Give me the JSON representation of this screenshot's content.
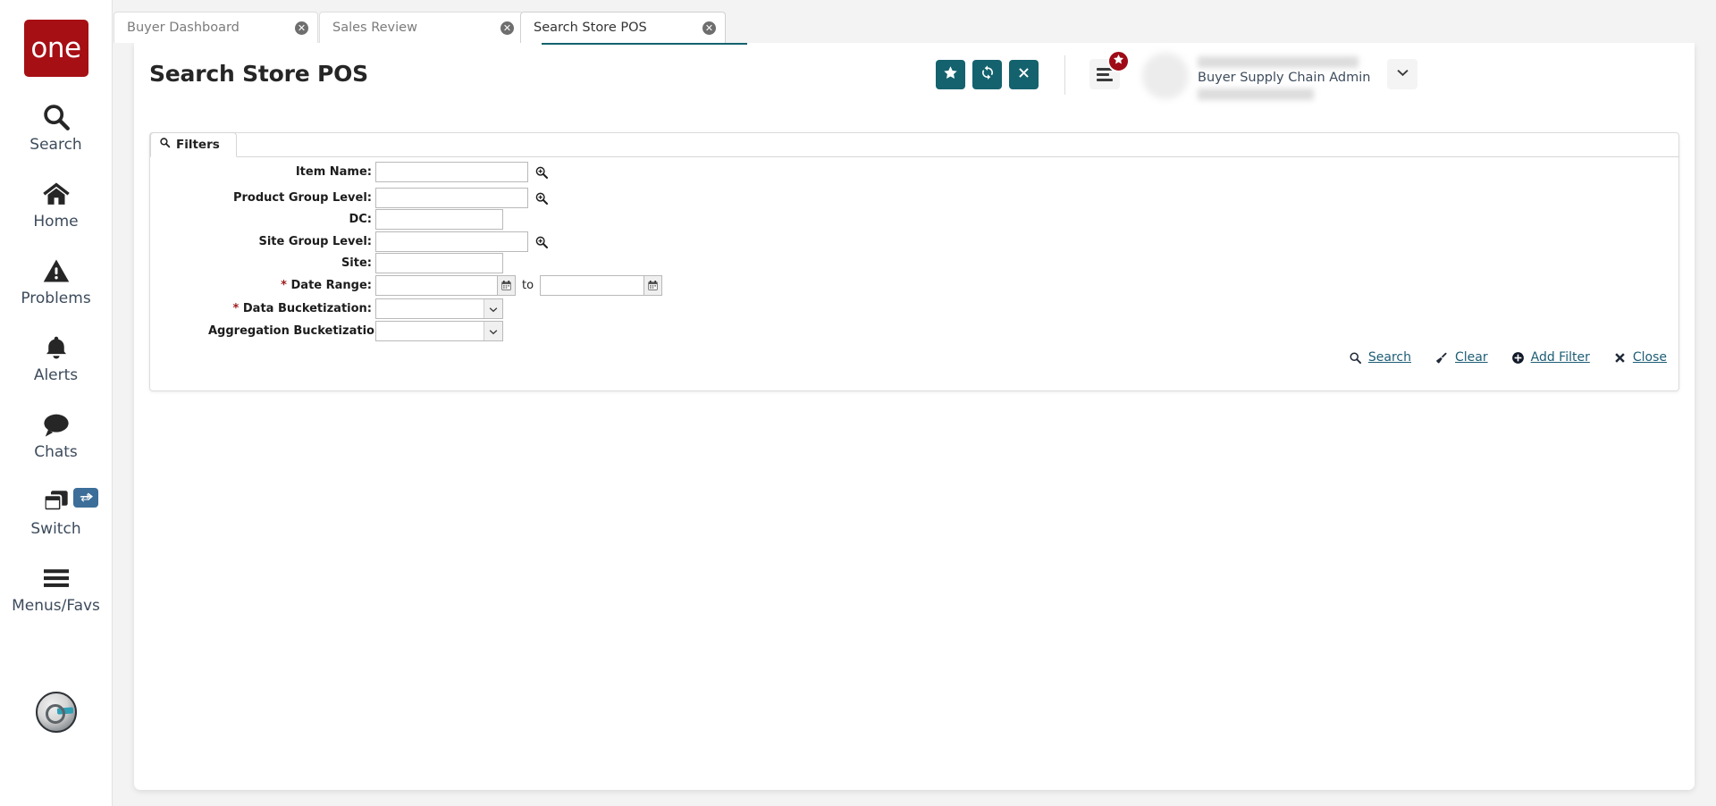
{
  "sidebar": {
    "logo_text": "one",
    "items": [
      {
        "label": "Search",
        "icon": "search-icon"
      },
      {
        "label": "Home",
        "icon": "home-icon"
      },
      {
        "label": "Problems",
        "icon": "warning-triangle-icon"
      },
      {
        "label": "Alerts",
        "icon": "bell-icon"
      },
      {
        "label": "Chats",
        "icon": "chat-bubble-icon"
      },
      {
        "label": "Switch",
        "icon": "windows-stack-icon",
        "badge_icon": "swap-arrows-icon"
      },
      {
        "label": "Menus/Favs",
        "icon": "hamburger-icon"
      }
    ],
    "assistant_icon": "ai-assistant-avatar-icon"
  },
  "tabs": [
    {
      "label": "Buyer Dashboard",
      "active": false,
      "close_icon": "close-circle-icon"
    },
    {
      "label": "Sales Review",
      "active": false,
      "close_icon": "close-circle-icon"
    },
    {
      "label": "Search Store POS",
      "active": true,
      "close_icon": "close-circle-icon"
    }
  ],
  "header": {
    "title": "Search Store POS",
    "buttons": [
      {
        "name": "favorite-button",
        "icon": "star-icon"
      },
      {
        "name": "refresh-button",
        "icon": "refresh-icon"
      },
      {
        "name": "close-button",
        "icon": "x-icon"
      }
    ],
    "menu_icon": "hamburger-menu-icon",
    "favorites_badge_icon": "star-icon",
    "user": {
      "name_masked": "██████ ██████",
      "role": "Buyer Supply Chain Admin",
      "org_masked": "████ ████"
    },
    "user_caret_icon": "chevron-down-icon",
    "accent_color": "#14626e",
    "badge_color": "#9e0b16"
  },
  "filters": {
    "tab_label": "Filters",
    "tab_icon": "search-icon",
    "rows": [
      {
        "label": "Item Name:",
        "required": false,
        "type": "text",
        "value": "",
        "lookup": true,
        "width": "long"
      },
      {
        "label": "Product Group Level:",
        "required": false,
        "type": "text",
        "value": "",
        "lookup": true,
        "width": "long"
      },
      {
        "label": "DC:",
        "required": false,
        "type": "text",
        "value": "",
        "lookup": false,
        "width": "short"
      },
      {
        "label": "Site Group Level:",
        "required": false,
        "type": "text",
        "value": "",
        "lookup": true,
        "width": "long"
      },
      {
        "label": "Site:",
        "required": false,
        "type": "text",
        "value": "",
        "lookup": false,
        "width": "short"
      },
      {
        "label": "Date Range:",
        "required": true,
        "type": "daterange",
        "value_from": "",
        "value_to": "",
        "separator": "to"
      },
      {
        "label": "Data Bucketization:",
        "required": true,
        "type": "select",
        "value": ""
      },
      {
        "label": "Aggregation Bucketization:",
        "required": false,
        "type": "select",
        "value": ""
      }
    ],
    "actions": [
      {
        "label": "Search",
        "icon": "search-icon"
      },
      {
        "label": "Clear",
        "icon": "broom-icon"
      },
      {
        "label": "Add Filter",
        "icon": "plus-circle-icon"
      },
      {
        "label": "Close",
        "icon": "x-icon"
      }
    ]
  }
}
